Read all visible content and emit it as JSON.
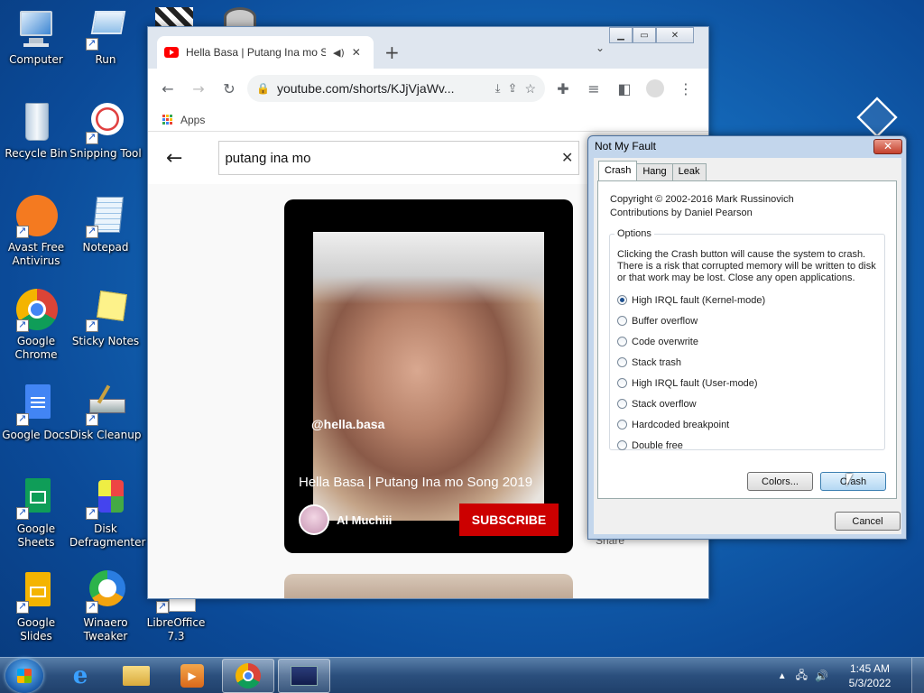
{
  "desktop": {
    "icons": [
      {
        "label": "Computer"
      },
      {
        "label": "Run"
      },
      {
        "label": "Recycle Bin"
      },
      {
        "label": "Snipping Tool"
      },
      {
        "label": "Avast Free Antivirus"
      },
      {
        "label": "Notepad"
      },
      {
        "label": "Google Chrome"
      },
      {
        "label": "Sticky Notes"
      },
      {
        "label": "Google Docs"
      },
      {
        "label": "Disk Cleanup"
      },
      {
        "label": "Google Sheets"
      },
      {
        "label": "Disk Defragmenter"
      },
      {
        "label": "Google Slides"
      },
      {
        "label": "Winaero Tweaker"
      },
      {
        "label": "LibreOffice 7.3"
      }
    ]
  },
  "chrome": {
    "tab_title": "Hella Basa | Putang Ina mo S",
    "url": "youtube.com/shorts/KJjVjaWv...",
    "bookmarks": {
      "apps_label": "Apps"
    },
    "youtube": {
      "search_value": "putang ina mo",
      "short": {
        "handle": "@hella.basa",
        "video_title": "Hella Basa | Putang Ina mo Song 2019",
        "channel": "Al Muchiii",
        "subscribe_label": "SUBSCRIBE"
      },
      "share_label": "Share"
    }
  },
  "notmyfault": {
    "title": "Not My Fault",
    "close_glyph": "✕",
    "tabs": [
      {
        "label": "Crash",
        "active": true
      },
      {
        "label": "Hang"
      },
      {
        "label": "Leak"
      }
    ],
    "copyright": "Copyright © 2002-2016 Mark Russinovich",
    "contributions": "Contributions by Daniel Pearson",
    "options_label": "Options",
    "warning": "Clicking the Crash button will cause the system to crash. There is a risk that corrupted memory will be written to disk or that work may be lost. Close any open applications.",
    "options": [
      {
        "label": "High IRQL fault (Kernel-mode)",
        "selected": true
      },
      {
        "label": "Buffer overflow",
        "selected": false
      },
      {
        "label": "Code overwrite",
        "selected": false
      },
      {
        "label": "Stack trash",
        "selected": false
      },
      {
        "label": "High IRQL fault (User-mode)",
        "selected": false
      },
      {
        "label": "Stack overflow",
        "selected": false
      },
      {
        "label": "Hardcoded breakpoint",
        "selected": false
      },
      {
        "label": "Double free",
        "selected": false
      }
    ],
    "colors_button": "Colors...",
    "crash_button": "Crash",
    "cancel_button": "Cancel"
  },
  "taskbar": {
    "time": "1:45 AM",
    "date": "5/3/2022"
  }
}
